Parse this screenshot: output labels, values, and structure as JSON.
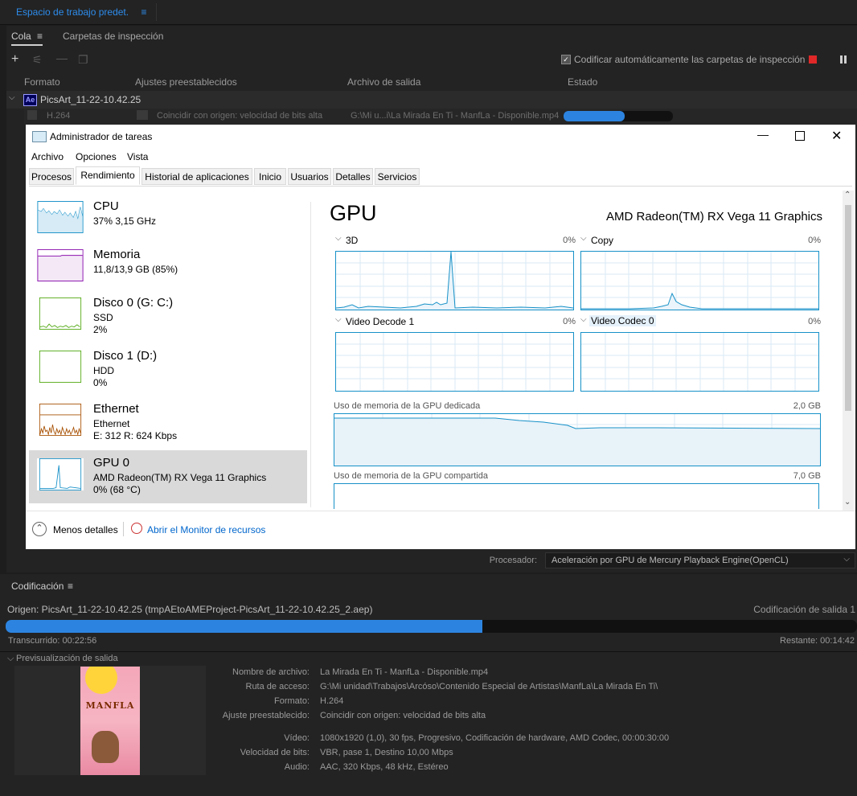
{
  "workspace": {
    "tab_label": "Espacio de trabajo predet.",
    "menu_icon": "≡"
  },
  "queue": {
    "tabs": [
      "Cola",
      "Carpetas de inspección"
    ],
    "auto_encode_label": "Codificar automáticamente las carpetas de inspección",
    "columns": [
      "Formato",
      "Ajustes preestablecidos",
      "Archivo de salida",
      "Estado"
    ],
    "item": {
      "name": "PicsArt_11-22-10.42.25",
      "format": "H.264",
      "preset": "Coincidir con origen: velocidad de bits alta",
      "output": "G:\\Mi u...i\\La Mirada En Ti - ManfLa - Disponible.mp4",
      "progress": 0.56
    },
    "processor_label": "Procesador:",
    "processor_value": "Aceleración por GPU de Mercury Playback Engine(OpenCL)"
  },
  "taskmanager": {
    "title": "Administrador de tareas",
    "menu": [
      "Archivo",
      "Opciones",
      "Vista"
    ],
    "tabs": [
      "Procesos",
      "Rendimiento",
      "Historial de aplicaciones",
      "Inicio",
      "Usuarios",
      "Detalles",
      "Servicios"
    ],
    "active_tab": "Rendimiento",
    "sidebar": [
      {
        "name": "CPU",
        "l1": "37% 3,15 GHz",
        "l2": "",
        "color": "#1791c8"
      },
      {
        "name": "Memoria",
        "l1": "11,8/13,9 GB (85%)",
        "l2": "",
        "color": "#8b12ae"
      },
      {
        "name": "Disco 0 (G: C:)",
        "l1": "SSD",
        "l2": "2%",
        "color": "#4da60c"
      },
      {
        "name": "Disco 1 (D:)",
        "l1": "HDD",
        "l2": "0%",
        "color": "#4da60c"
      },
      {
        "name": "Ethernet",
        "l1": "Ethernet",
        "l2": "E: 312 R: 624 Kbps",
        "color": "#a74f01"
      },
      {
        "name": "GPU 0",
        "l1": "AMD Radeon(TM) RX Vega 11 Graphics",
        "l2": "0% (68 °C)",
        "color": "#1791c8"
      }
    ],
    "gpu_title": "GPU",
    "gpu_model": "AMD Radeon(TM) RX Vega 11 Graphics",
    "engines": [
      {
        "label": "3D",
        "pct": "0%"
      },
      {
        "label": "Copy",
        "pct": "0%"
      },
      {
        "label": "Video Decode 1",
        "pct": "0%"
      },
      {
        "label": "Video Codec 0",
        "pct": "0%"
      }
    ],
    "dedicated_label": "Uso de memoria de la GPU dedicada",
    "dedicated_value": "2,0 GB",
    "shared_label": "Uso de memoria de la GPU compartida",
    "shared_value": "7,0 GB",
    "less_details": "Menos detalles",
    "resource_monitor": "Abrir el Monitor de recursos"
  },
  "encoding": {
    "panel_title": "Codificación",
    "source": "Origen: PicsArt_11-22-10.42.25 (tmpAEtoAMEProject-PicsArt_11-22-10.42.25_2.aep)",
    "output_label": "Codificación de salida 1",
    "progress": 0.56,
    "elapsed": "Transcurrido: 00:22:56",
    "remaining": "Restante: 00:14:42",
    "preview_label": "Previsualización de salida",
    "thumb_text": "MANFLA",
    "details": [
      {
        "label": "Nombre de archivo:",
        "value": "La Mirada En Ti - ManfLa - Disponible.mp4"
      },
      {
        "label": "Ruta de acceso:",
        "value": "G:\\Mi unidad\\Trabajos\\Arcóso\\Contenido Especial de Artistas\\ManfLa\\La Mirada En Ti\\"
      },
      {
        "label": "Formato:",
        "value": "H.264"
      },
      {
        "label": "Ajuste preestablecido:",
        "value": "Coincidir con origen: velocidad de bits alta"
      },
      {
        "label": "Vídeo:",
        "value": "1080x1920 (1,0), 30 fps, Progresivo, Codificación de hardware, AMD Codec, 00:00:30:00"
      },
      {
        "label": "Velocidad de bits:",
        "value": "VBR, pase 1, Destino 10,00 Mbps"
      },
      {
        "label": "Audio:",
        "value": "AAC, 320 Kbps, 48 kHz, Estéreo"
      }
    ]
  }
}
